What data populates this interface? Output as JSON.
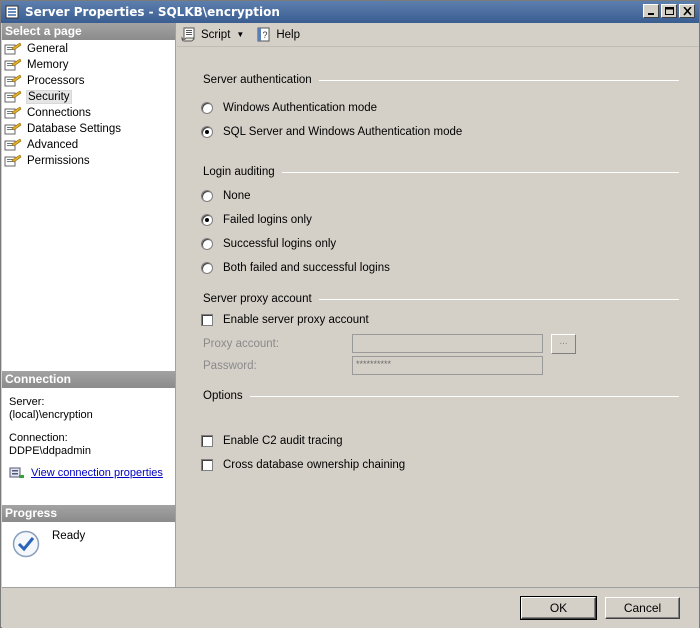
{
  "window": {
    "title": "Server Properties - SQLKB\\encryption"
  },
  "left": {
    "select_page_header": "Select a page",
    "pages": [
      {
        "label": "General",
        "selected": false
      },
      {
        "label": "Memory",
        "selected": false
      },
      {
        "label": "Processors",
        "selected": false
      },
      {
        "label": "Security",
        "selected": true
      },
      {
        "label": "Connections",
        "selected": false
      },
      {
        "label": "Database Settings",
        "selected": false
      },
      {
        "label": "Advanced",
        "selected": false
      },
      {
        "label": "Permissions",
        "selected": false
      }
    ],
    "connection": {
      "header": "Connection",
      "server_label": "Server:",
      "server_value": "(local)\\encryption",
      "connection_label": "Connection:",
      "connection_value": "DDPE\\ddpadmin",
      "link": "View connection properties"
    },
    "progress": {
      "header": "Progress",
      "status": "Ready"
    }
  },
  "toolbar": {
    "script": "Script",
    "help": "Help"
  },
  "security": {
    "server_auth": {
      "header": "Server authentication",
      "options": [
        {
          "label": "Windows Authentication mode",
          "selected": false
        },
        {
          "label": "SQL Server and Windows Authentication mode",
          "selected": true
        }
      ]
    },
    "login_auditing": {
      "header": "Login auditing",
      "options": [
        {
          "label": "None",
          "selected": false
        },
        {
          "label": "Failed logins only",
          "selected": true
        },
        {
          "label": "Successful logins only",
          "selected": false
        },
        {
          "label": "Both failed and successful logins",
          "selected": false
        }
      ]
    },
    "proxy": {
      "header": "Server proxy account",
      "enable_label": "Enable server proxy account",
      "enabled": false,
      "account_label": "Proxy account:",
      "account_value": "",
      "password_label": "Password:",
      "password_value": "**********",
      "browse_label": "..."
    },
    "options": {
      "header": "Options",
      "c2_label": "Enable C2 audit tracing",
      "c2_checked": false,
      "chaining_label": "Cross database ownership chaining",
      "chaining_checked": false
    }
  },
  "buttons": {
    "ok": "OK",
    "cancel": "Cancel"
  },
  "colors": {
    "title_bar": "#3a5d91",
    "panel_header": "#8b8b8b",
    "link": "#0000c0",
    "dialog_bg": "#d4d0c8"
  }
}
